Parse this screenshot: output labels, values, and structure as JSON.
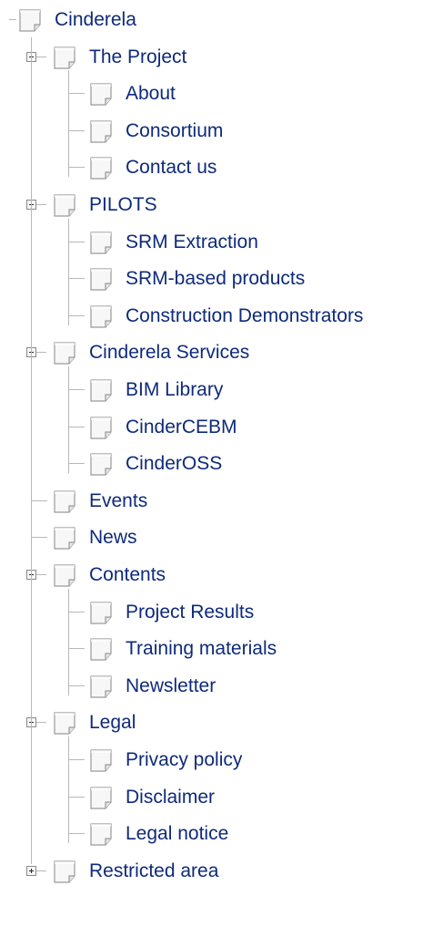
{
  "tree": {
    "root": {
      "label": "Cinderela",
      "icon": "document-icon"
    },
    "items": [
      {
        "label": "The Project",
        "state": "expanded",
        "icon": "document-icon",
        "children": [
          {
            "label": "About"
          },
          {
            "label": "Consortium"
          },
          {
            "label": "Contact us"
          }
        ]
      },
      {
        "label": "PILOTS",
        "state": "expanded",
        "icon": "document-icon",
        "children": [
          {
            "label": "SRM Extraction"
          },
          {
            "label": "SRM-based products"
          },
          {
            "label": "Construction Demonstrators"
          }
        ]
      },
      {
        "label": "Cinderela Services",
        "state": "expanded",
        "icon": "document-icon",
        "children": [
          {
            "label": "BIM Library"
          },
          {
            "label": "CinderCEBM"
          },
          {
            "label": "CinderOSS"
          }
        ]
      },
      {
        "label": "Events",
        "state": "leaf",
        "icon": "document-icon",
        "children": []
      },
      {
        "label": "News",
        "state": "leaf",
        "icon": "document-icon",
        "children": []
      },
      {
        "label": "Contents",
        "state": "expanded",
        "icon": "document-icon",
        "children": [
          {
            "label": "Project Results"
          },
          {
            "label": "Training materials"
          },
          {
            "label": "Newsletter"
          }
        ]
      },
      {
        "label": "Legal",
        "state": "expanded",
        "icon": "document-icon",
        "children": [
          {
            "label": "Privacy policy"
          },
          {
            "label": "Disclaimer"
          },
          {
            "label": "Legal notice"
          }
        ]
      },
      {
        "label": "Restricted area",
        "state": "collapsed",
        "icon": "document-icon",
        "children": []
      }
    ]
  },
  "colors": {
    "link": "#0e2a7a",
    "connector": "#b8b8b8"
  }
}
